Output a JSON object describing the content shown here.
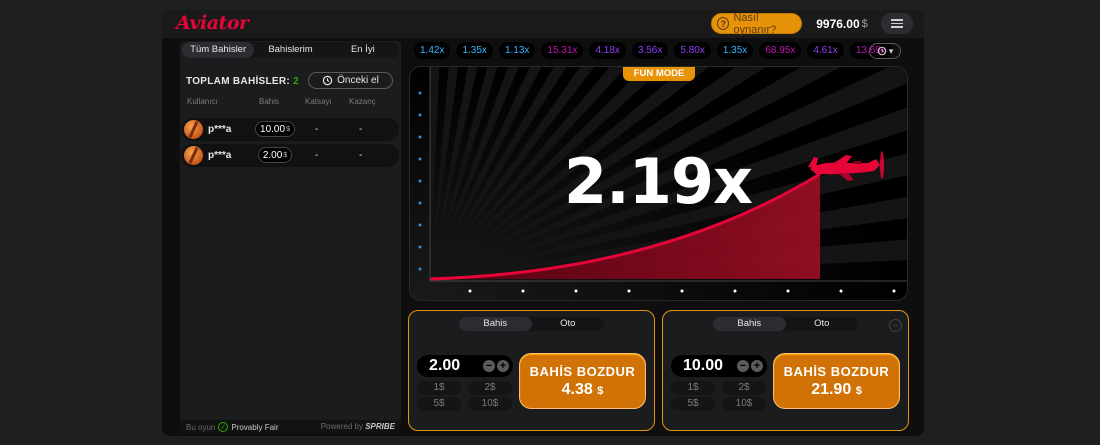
{
  "header": {
    "logo": "Aviator",
    "how_to_play": "Nasıl oynanır?",
    "how_icon": "question-icon",
    "balance": "9976.00",
    "currency": "$"
  },
  "left": {
    "tabs": [
      {
        "label": "Tüm Bahisler",
        "active": true
      },
      {
        "label": "Bahislerim",
        "active": false
      },
      {
        "label": "En İyi",
        "active": false
      }
    ],
    "total_label": "TOPLAM BAHİSLER:",
    "total_count": "2",
    "prev_button": "Önceki el",
    "columns": [
      "Kullanıcı",
      "Bahis",
      "Katsayı",
      "Kazanç"
    ],
    "rows": [
      {
        "user": "p***a",
        "bet": "10.00",
        "currency": "$",
        "multiplier": "-",
        "win": "-"
      },
      {
        "user": "p***a",
        "bet": "2.00",
        "currency": "$",
        "multiplier": "-",
        "win": "-"
      }
    ],
    "footer": {
      "prefix": "Bu oyun",
      "provably_fair": "Provably Fair",
      "powered_by": "Powered by",
      "brand": "SPRIBE"
    }
  },
  "history": [
    {
      "value": "1.42x",
      "color": "#34b4ff"
    },
    {
      "value": "1.35x",
      "color": "#34b4ff"
    },
    {
      "value": "1.13x",
      "color": "#34b4ff"
    },
    {
      "value": "15.31x",
      "color": "#c017b4"
    },
    {
      "value": "4.18x",
      "color": "#913ef8"
    },
    {
      "value": "3.56x",
      "color": "#913ef8"
    },
    {
      "value": "5.80x",
      "color": "#913ef8"
    },
    {
      "value": "1.35x",
      "color": "#34b4ff"
    },
    {
      "value": "68.95x",
      "color": "#c017b4"
    },
    {
      "value": "4.61x",
      "color": "#913ef8"
    },
    {
      "value": "13.69x",
      "color": "#c017b4"
    }
  ],
  "game": {
    "mode_badge": "FUN MODE",
    "multiplier": "2.19x",
    "plane_icon": "airplane-icon"
  },
  "bet_panels": [
    {
      "tabs": [
        "Bahis",
        "Oto"
      ],
      "stake": "2.00",
      "quick_amounts": [
        "1$",
        "2$",
        "5$",
        "10$"
      ],
      "cashout_label": "BAHİS BOZDUR",
      "cashout_amount": "4.38",
      "currency": "$"
    },
    {
      "tabs": [
        "Bahis",
        "Oto"
      ],
      "stake": "10.00",
      "quick_amounts": [
        "1$",
        "2$",
        "5$",
        "10$"
      ],
      "cashout_label": "BAHİS BOZDUR",
      "cashout_amount": "21.90",
      "currency": "$"
    }
  ],
  "colors": {
    "brand_red": "#e50539",
    "accent_orange": "#e69308",
    "count_green": "#28a909"
  }
}
